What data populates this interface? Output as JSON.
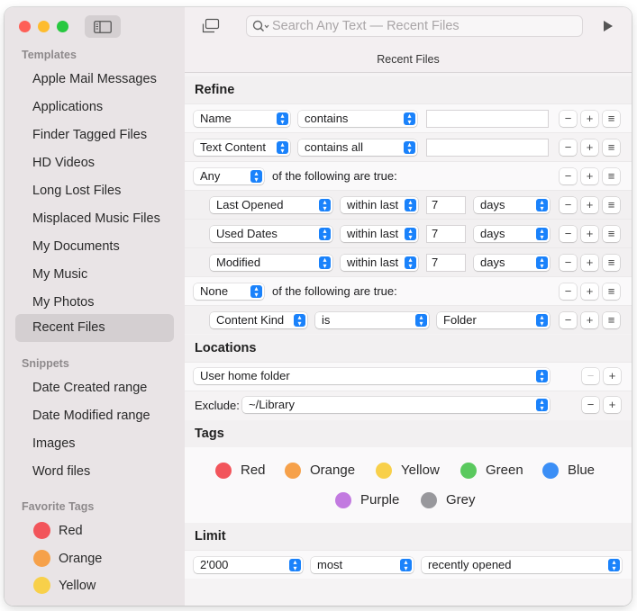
{
  "sidebar": {
    "templates_header": "Templates",
    "templates": [
      {
        "label": "Apple Mail Messages"
      },
      {
        "label": "Applications"
      },
      {
        "label": "Finder Tagged Files"
      },
      {
        "label": "HD Videos"
      },
      {
        "label": "Long Lost Files"
      },
      {
        "label": "Misplaced Music Files"
      },
      {
        "label": "My Documents"
      },
      {
        "label": "My Music"
      },
      {
        "label": "My Photos"
      },
      {
        "label": "Recent Files",
        "selected": true
      }
    ],
    "snippets_header": "Snippets",
    "snippets": [
      {
        "label": "Date Created range"
      },
      {
        "label": "Date Modified range"
      },
      {
        "label": "Images"
      },
      {
        "label": "Word files"
      }
    ],
    "favorite_tags_header": "Favorite Tags",
    "favorite_tags": [
      {
        "label": "Red",
        "color": "#f2555b"
      },
      {
        "label": "Orange",
        "color": "#f6a14a"
      },
      {
        "label": "Yellow",
        "color": "#f8d04a"
      }
    ]
  },
  "toolbar": {
    "search_placeholder": "Search Any Text — Recent Files",
    "subtitle": "Recent Files"
  },
  "refine": {
    "header": "Refine",
    "rows": [
      {
        "field": "Name",
        "operator": "contains",
        "value": ""
      },
      {
        "field": "Text Content",
        "operator": "contains all",
        "value": ""
      },
      {
        "quantifier": "Any",
        "suffix": "of the following are true:"
      },
      {
        "field": "Last Opened",
        "operator": "within last",
        "value": "7",
        "unit": "days"
      },
      {
        "field": "Used Dates",
        "operator": "within last",
        "value": "7",
        "unit": "days"
      },
      {
        "field": "Modified",
        "operator": "within last",
        "value": "7",
        "unit": "days"
      },
      {
        "quantifier": "None",
        "suffix": "of the following are true:"
      },
      {
        "field": "Content Kind",
        "operator": "is",
        "value": "Folder"
      }
    ]
  },
  "locations": {
    "header": "Locations",
    "location": "User home folder",
    "exclude_label": "Exclude:",
    "exclude": "~/Library"
  },
  "tags": {
    "header": "Tags",
    "items": [
      {
        "label": "Red",
        "color": "#f2555b"
      },
      {
        "label": "Orange",
        "color": "#f6a14a"
      },
      {
        "label": "Yellow",
        "color": "#f8d04a"
      },
      {
        "label": "Green",
        "color": "#5ac95e"
      },
      {
        "label": "Blue",
        "color": "#3b8ff6"
      },
      {
        "label": "Purple",
        "color": "#c27ae0"
      },
      {
        "label": "Grey",
        "color": "#98989c"
      }
    ]
  },
  "limit": {
    "header": "Limit",
    "count": "2'000",
    "order": "most",
    "sort": "recently opened"
  },
  "buttons": {
    "minus": "−",
    "plus": "+",
    "menu": "≡"
  },
  "colors": {
    "accent": "#1a82fb",
    "close": "#fe5f57",
    "minimize": "#febc2e",
    "zoom": "#28c840"
  }
}
